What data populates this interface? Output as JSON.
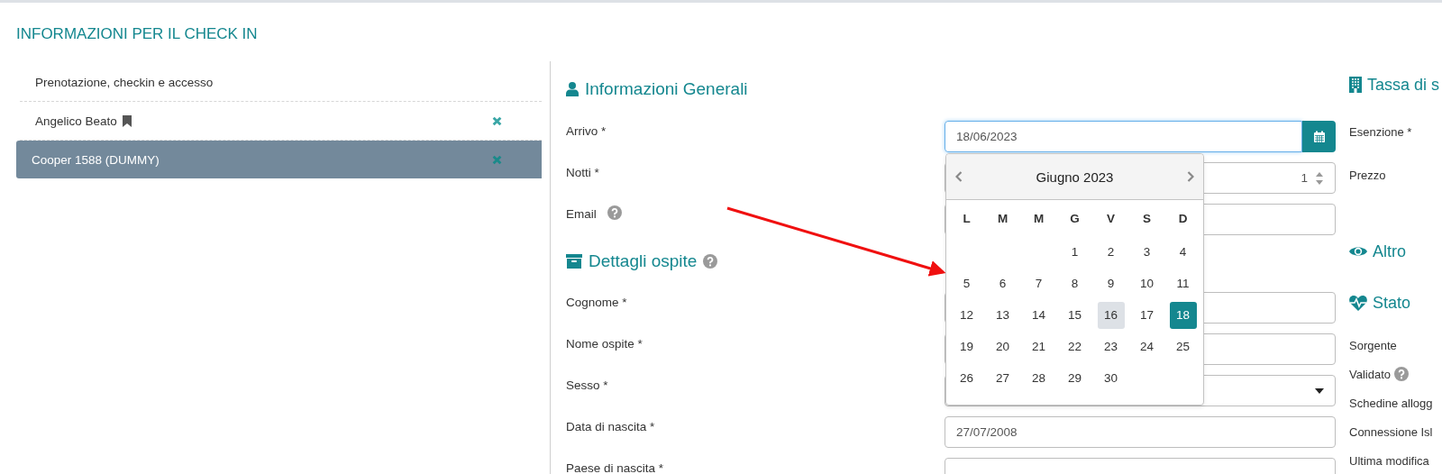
{
  "title": "INFORMAZIONI PER IL CHECK IN",
  "sidebar": {
    "items": [
      {
        "label": "Prenotazione, checkin e accesso",
        "kind": "section",
        "bookmarked": false,
        "selected": false
      },
      {
        "label": "Angelico Beato",
        "kind": "guest",
        "bookmarked": true,
        "selected": false
      },
      {
        "label": "Cooper 1588 (DUMMY)",
        "kind": "guest",
        "bookmarked": false,
        "selected": true
      }
    ]
  },
  "general": {
    "heading": "Informazioni Generali",
    "fields": [
      {
        "label": "Arrivo *",
        "kind": "date",
        "value": "18/06/2023",
        "focused": true,
        "help": false
      },
      {
        "label": "Notti *",
        "kind": "number",
        "value": "1",
        "focused": false,
        "help": false
      },
      {
        "label": "Email",
        "kind": "text",
        "focused": false,
        "help": true
      }
    ]
  },
  "guest": {
    "heading": "Dettagli ospite",
    "help": true,
    "fields": [
      {
        "label": "Cognome *",
        "kind": "text",
        "focused": false,
        "help": false
      },
      {
        "label": "Nome ospite *",
        "kind": "text",
        "focused": false,
        "help": false
      },
      {
        "label": "Sesso *",
        "kind": "select",
        "focused": false,
        "help": false
      },
      {
        "label": "Data di nascita *",
        "kind": "text",
        "value": "27/07/2008",
        "focused": false,
        "help": false
      },
      {
        "label": "Paese di nascita *",
        "kind": "text",
        "focused": false,
        "help": false
      }
    ]
  },
  "datepicker": {
    "month": "Giugno 2023",
    "weekdays": [
      "L",
      "M",
      "M",
      "G",
      "V",
      "S",
      "D"
    ],
    "weeks": [
      [
        {
          "kind": "blank"
        },
        {
          "kind": "blank"
        },
        {
          "kind": "blank"
        },
        {
          "kind": "day",
          "day": "1",
          "today": false,
          "selected": false
        },
        {
          "kind": "day",
          "day": "2",
          "today": false,
          "selected": false
        },
        {
          "kind": "day",
          "day": "3",
          "today": false,
          "selected": false
        },
        {
          "kind": "day",
          "day": "4",
          "today": false,
          "selected": false
        }
      ],
      [
        {
          "kind": "day",
          "day": "5",
          "today": false,
          "selected": false
        },
        {
          "kind": "day",
          "day": "6",
          "today": false,
          "selected": false
        },
        {
          "kind": "day",
          "day": "7",
          "today": false,
          "selected": false
        },
        {
          "kind": "day",
          "day": "8",
          "today": false,
          "selected": false
        },
        {
          "kind": "day",
          "day": "9",
          "today": false,
          "selected": false
        },
        {
          "kind": "day",
          "day": "10",
          "today": false,
          "selected": false
        },
        {
          "kind": "day",
          "day": "11",
          "today": false,
          "selected": false
        }
      ],
      [
        {
          "kind": "day",
          "day": "12",
          "today": false,
          "selected": false
        },
        {
          "kind": "day",
          "day": "13",
          "today": false,
          "selected": false
        },
        {
          "kind": "day",
          "day": "14",
          "today": false,
          "selected": false
        },
        {
          "kind": "day",
          "day": "15",
          "today": false,
          "selected": false
        },
        {
          "kind": "day",
          "day": "16",
          "today": true,
          "selected": false
        },
        {
          "kind": "day",
          "day": "17",
          "today": false,
          "selected": false
        },
        {
          "kind": "day",
          "day": "18",
          "today": false,
          "selected": true
        }
      ],
      [
        {
          "kind": "day",
          "day": "19",
          "today": false,
          "selected": false
        },
        {
          "kind": "day",
          "day": "20",
          "today": false,
          "selected": false
        },
        {
          "kind": "day",
          "day": "21",
          "today": false,
          "selected": false
        },
        {
          "kind": "day",
          "day": "22",
          "today": false,
          "selected": false
        },
        {
          "kind": "day",
          "day": "23",
          "today": false,
          "selected": false
        },
        {
          "kind": "day",
          "day": "24",
          "today": false,
          "selected": false
        },
        {
          "kind": "day",
          "day": "25",
          "today": false,
          "selected": false
        }
      ],
      [
        {
          "kind": "day",
          "day": "26",
          "today": false,
          "selected": false
        },
        {
          "kind": "day",
          "day": "27",
          "today": false,
          "selected": false
        },
        {
          "kind": "day",
          "day": "28",
          "today": false,
          "selected": false
        },
        {
          "kind": "day",
          "day": "29",
          "today": false,
          "selected": false
        },
        {
          "kind": "day",
          "day": "30",
          "today": false,
          "selected": false
        },
        {
          "kind": "blank"
        },
        {
          "kind": "blank"
        }
      ]
    ]
  },
  "tax": {
    "heading": "Tassa di s",
    "fields": [
      "Esenzione *",
      "Prezzo"
    ]
  },
  "other": {
    "heading": "Altro"
  },
  "status": {
    "heading": "Stato",
    "fields": [
      {
        "label": "Sorgente",
        "help": false
      },
      {
        "label": "Validato",
        "help": true
      },
      {
        "label": "Schedine allogg",
        "help": false
      },
      {
        "label": "Connessione Isl",
        "help": false
      },
      {
        "label": "Ultima modifica",
        "help": false
      }
    ]
  }
}
